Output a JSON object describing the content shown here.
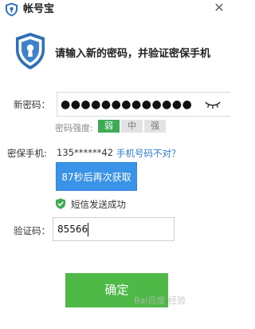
{
  "window": {
    "title": "帐号宝",
    "close_icon": "close-icon"
  },
  "header": {
    "instruction": "请输入新的密码，并验证密保手机"
  },
  "password": {
    "label": "新密码：",
    "masked_value": "●●●●●●●●●●●●●",
    "toggle_icon": "eye-closed-icon",
    "strength_label": "密码强度:",
    "strength_levels": [
      "弱",
      "中",
      "强"
    ],
    "active_level": "弱"
  },
  "phone": {
    "label": "密保手机:",
    "number": "135******42",
    "wrong_number_link": "手机号码不对？"
  },
  "resend": {
    "label": "87秒后再次获取"
  },
  "sms_status": {
    "text": "短信发送成功",
    "icon": "check-shield-icon"
  },
  "verify": {
    "label": "验证码：",
    "value": "85566"
  },
  "confirm": {
    "label": "确定"
  },
  "watermark": {
    "text": "Bai百度 经验"
  },
  "colors": {
    "accent_blue": "#3a93e6",
    "confirm_green": "#4fb948",
    "strength_weak": "#3eaa56",
    "link": "#2d7cd6"
  }
}
